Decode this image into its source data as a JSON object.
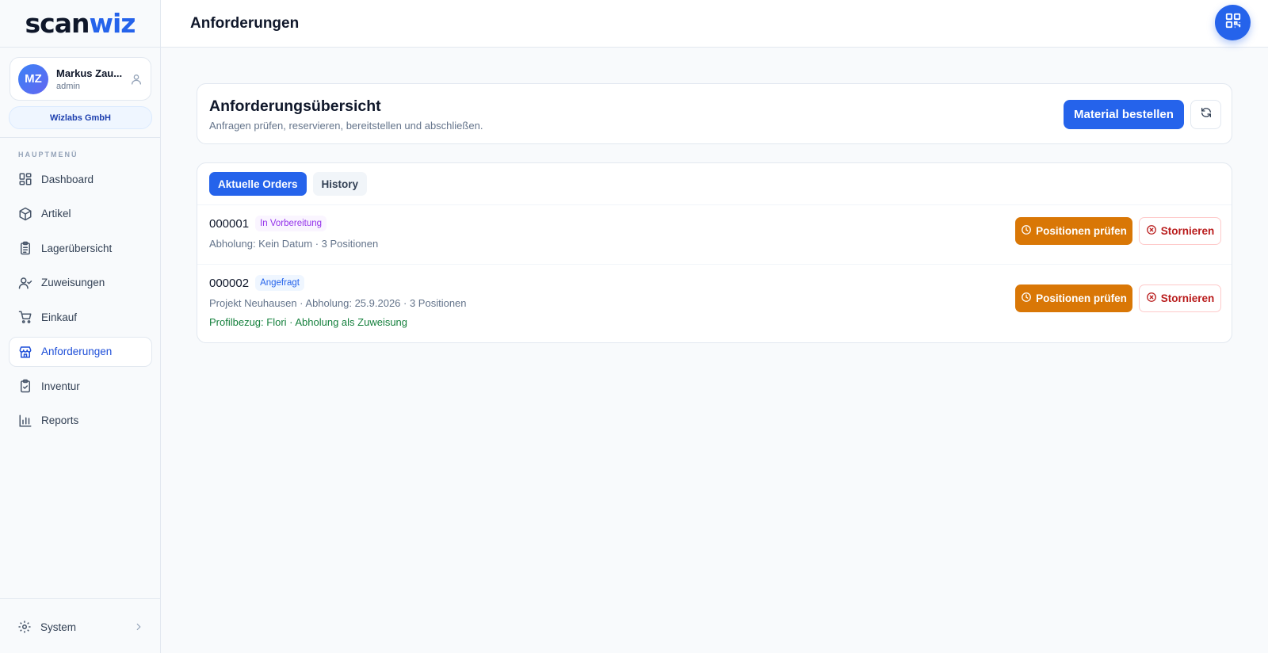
{
  "app": {
    "logo_part1": "scan",
    "logo_part2": "wiz"
  },
  "user": {
    "initials": "MZ",
    "name": "Markus Zau...",
    "role": "admin",
    "company": "Wizlabs GmbH"
  },
  "sidebar": {
    "section_title": "HAUPTMENÜ",
    "items": [
      {
        "label": "Dashboard",
        "icon": "dashboard-icon"
      },
      {
        "label": "Artikel",
        "icon": "box-icon"
      },
      {
        "label": "Lagerübersicht",
        "icon": "clipboard-list-icon"
      },
      {
        "label": "Zuweisungen",
        "icon": "user-check-icon"
      },
      {
        "label": "Einkauf",
        "icon": "cart-icon"
      },
      {
        "label": "Anforderungen",
        "icon": "store-icon",
        "active": true
      },
      {
        "label": "Inventur",
        "icon": "clipboard-check-icon"
      },
      {
        "label": "Reports",
        "icon": "bar-chart-icon"
      }
    ],
    "system_label": "System"
  },
  "header": {
    "title": "Anforderungen"
  },
  "overview": {
    "title": "Anforderungsübersicht",
    "subtitle": "Anfragen prüfen, reservieren, bereitstellen und abschließen.",
    "primary_button": "Material bestellen"
  },
  "tabs": [
    {
      "label": "Aktuelle Orders",
      "active": true
    },
    {
      "label": "History",
      "active": false
    }
  ],
  "orders": [
    {
      "id": "000001",
      "status": "In Vorbereitung",
      "meta": "Abholung: Kein Datum · 3 Positionen",
      "extra": "",
      "check_label": "Positionen prüfen",
      "cancel_label": "Stornieren"
    },
    {
      "id": "000002",
      "status": "Angefragt",
      "meta": "Projekt Neuhausen · Abholung: 25.9.2026 · 3 Positionen",
      "extra": "Profilbezug: Flori · Abholung als Zuweisung",
      "check_label": "Positionen prüfen",
      "cancel_label": "Stornieren"
    }
  ],
  "colors": {
    "accent": "#2563eb",
    "warning": "#d97706",
    "danger": "#b91c1c",
    "success": "#15803d",
    "purple": "#9333ea"
  }
}
